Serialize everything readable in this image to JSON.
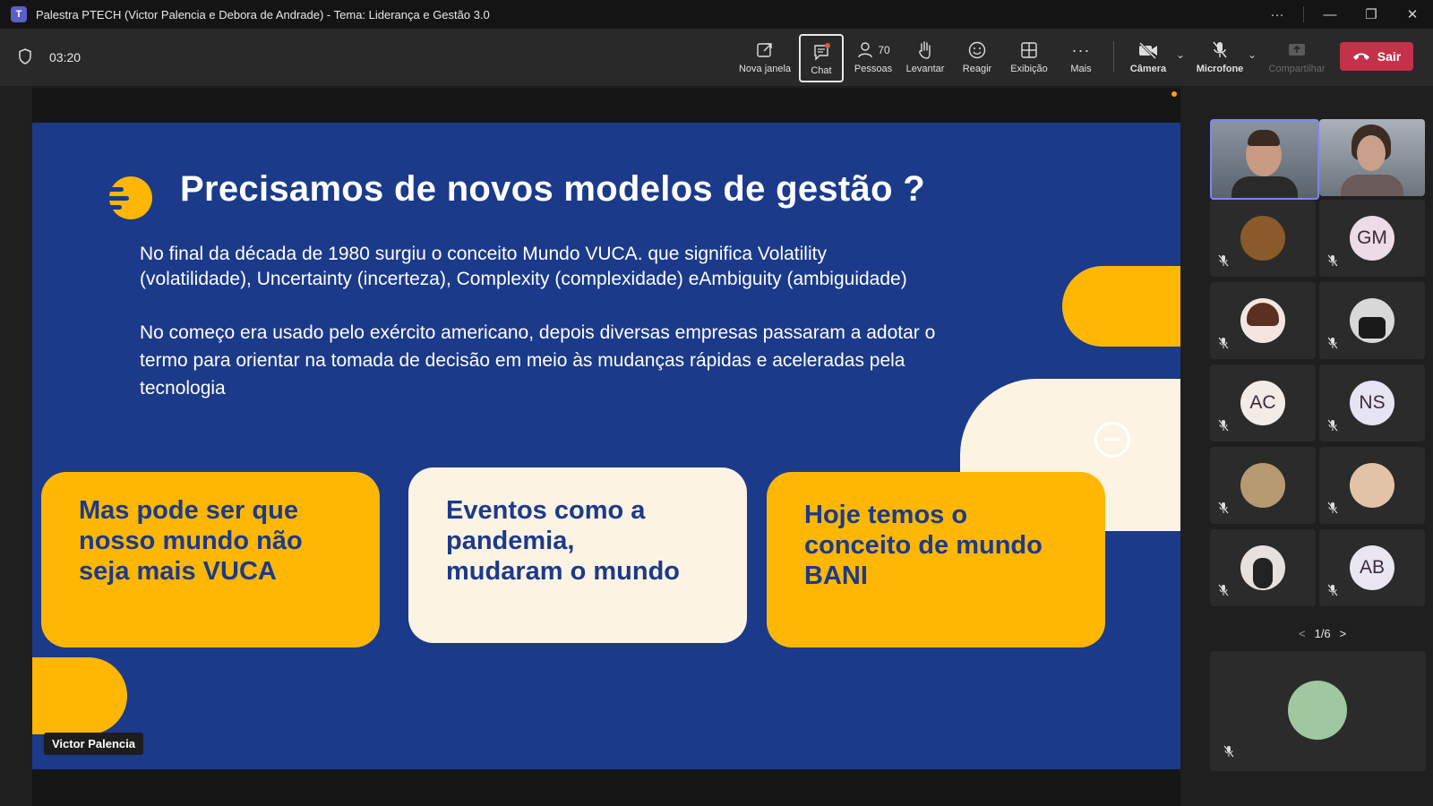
{
  "window": {
    "title": "Palestra PTECH (Victor Palencia e Debora de Andrade) - Tema: Liderança e Gestão 3.0",
    "controls": {
      "more": "···",
      "minimize": "—",
      "restore": "❐",
      "close": "✕"
    }
  },
  "meeting": {
    "timer": "03:20",
    "toolbar": {
      "new_window": "Nova janela",
      "chat": "Chat",
      "people": "Pessoas",
      "people_count": "70",
      "raise_hand": "Levantar",
      "react": "Reagir",
      "view": "Exibição",
      "more": "Mais",
      "camera": "Câmera",
      "mic": "Microfone",
      "share": "Compartilhar",
      "leave": "Sair"
    }
  },
  "slide": {
    "title": "Precisamos de novos modelos de gestão ?",
    "para1_line1": "No final da década de 1980 surgiu o conceito Mundo VUCA. que significa Volatility",
    "para1_line2": "(volatilidade), Uncertainty (incerteza), Complexity (complexidade) eAmbiguity (ambiguidade)",
    "para2_line1": "No começo era usado pelo exército americano, depois diversas empresas passaram a adotar o",
    "para2_line2": "termo para orientar na tomada de decisão em meio às mudanças rápidas e aceleradas pela",
    "para2_line3": "tecnologia",
    "card1": [
      "Mas pode ser que",
      "nosso mundo não",
      "seja mais VUCA"
    ],
    "card2": [
      "Eventos como a",
      "pandemia,",
      "mudaram o mundo"
    ],
    "card3": [
      "Hoje temos o",
      "conceito de mundo",
      "BANI"
    ]
  },
  "speaker_label": "Victor Palencia",
  "participants": {
    "initials": [
      "GM",
      "AC",
      "NS",
      "AB"
    ],
    "page": "1/6"
  },
  "colors": {
    "slide_blue": "#1b3a8a",
    "slide_yellow": "#ffb703",
    "slide_cream": "#fdf3e3",
    "leave_red": "#c4314b",
    "teams_purple": "#5b5fc7"
  }
}
